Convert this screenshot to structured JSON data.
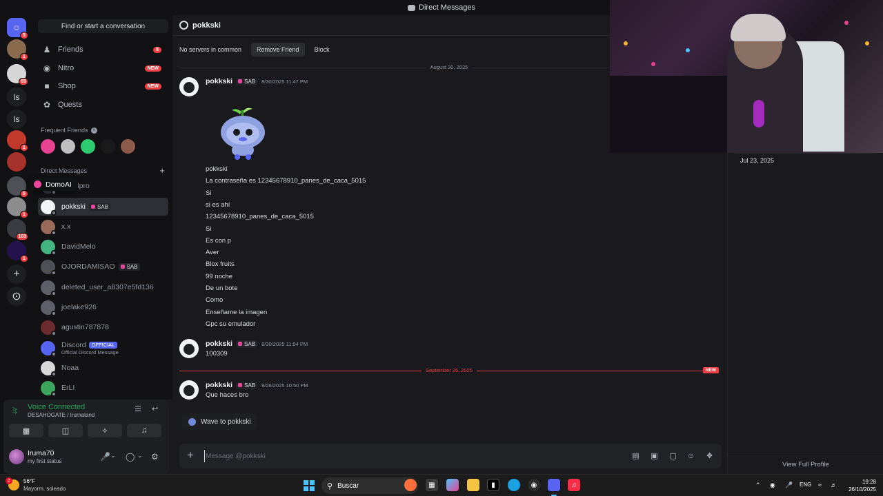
{
  "window": {
    "title": "Direct Messages"
  },
  "servers": [
    {
      "label": "",
      "badge": "5",
      "color": "#5865f2",
      "kind": "home"
    },
    {
      "label": "",
      "badge": "1",
      "color": "#8a6b4e"
    },
    {
      "label": "",
      "badge": "55",
      "color": "#d6d6d6"
    },
    {
      "label": "ls",
      "badge": "",
      "color": "#1e1f22"
    },
    {
      "label": "ls",
      "badge": "",
      "color": "#1e1f22"
    },
    {
      "label": "",
      "badge": "1",
      "color": "#c0392b"
    },
    {
      "label": "",
      "badge": "",
      "color": "#a6322b"
    },
    {
      "label": "",
      "badge": "5",
      "color": "#4e5058"
    },
    {
      "label": "",
      "badge": "1",
      "color": "#8d8d8d"
    },
    {
      "label": "",
      "badge": "103",
      "color": "#3a3c43"
    },
    {
      "label": "",
      "badge": "1",
      "color": "#24124f"
    }
  ],
  "rail_actions": {
    "add": "+",
    "discover": "⊙"
  },
  "tooltip": {
    "text": "DomoAI"
  },
  "sidebar": {
    "search_label": "Find or start a conversation",
    "nav": [
      {
        "label": "Friends",
        "badge": "5"
      },
      {
        "label": "Nitro",
        "badge": "NEW"
      },
      {
        "label": "Shop",
        "badge": "NEW"
      },
      {
        "label": "Quests",
        "badge": ""
      }
    ],
    "frequent_friends_label": "Frequent Friends",
    "frequent_friends_colors": [
      "#e84393",
      "#bfbfbf",
      "#2ecc71",
      "#1a1a1a",
      "#8d5b4c"
    ],
    "direct_messages_label": "Direct Messages",
    "dms": [
      {
        "name": "streelpro",
        "tag": "",
        "official": "",
        "sub": "",
        "color": "#3a3c43"
      },
      {
        "name": "pokkski",
        "tag": "SAB",
        "official": "",
        "sub": "",
        "color": "#f2f3f5"
      },
      {
        "name": "x.x",
        "tag": "",
        "official": "",
        "sub": "",
        "color": "#9b6b5a"
      },
      {
        "name": "DavidMelo",
        "tag": "",
        "official": "",
        "sub": "",
        "color": "#43b581"
      },
      {
        "name": "OJORDAMISAO",
        "tag": "SAB",
        "official": "",
        "sub": "",
        "color": "#4e5058"
      },
      {
        "name": "deleted_user_a8307e5fd136",
        "tag": "",
        "official": "",
        "sub": "",
        "color": "#5d6068"
      },
      {
        "name": "joelake926",
        "tag": "",
        "official": "",
        "sub": "",
        "color": "#5d6068"
      },
      {
        "name": "agustin787878",
        "tag": "",
        "official": "",
        "sub": "",
        "color": "#6b2d2d"
      },
      {
        "name": "Discord",
        "tag": "",
        "official": "OFFICIAL",
        "sub": "Official Discord Message",
        "color": "#5865f2"
      },
      {
        "name": "Noaa",
        "tag": "",
        "official": "",
        "sub": "",
        "color": "#d8d8d8"
      },
      {
        "name": "ErLI",
        "tag": "",
        "official": "",
        "sub": "",
        "color": "#3ba55c"
      }
    ]
  },
  "voice": {
    "status": "Voice Connected",
    "channel": "DESAHOGATE / Irumaland"
  },
  "user": {
    "name": "Iruma70",
    "status": "my first status"
  },
  "chat": {
    "header_name": "pokkski",
    "no_servers": "No servers in common",
    "remove_friend": "Remove Friend",
    "block": "Block",
    "date_1": "August 30, 2025",
    "date_2": "September 26, 2025",
    "new_label": "NEW",
    "messages": [
      {
        "author": "pokkski",
        "tag": "SAB",
        "time": "8/30/2025 11:47 PM",
        "lines": [
          "pokkski",
          "La contraseña es 12345678910_panes_de_caca_5015",
          "Si",
          "si es ahí",
          "12345678910_panes_de_caca_5015",
          "Si",
          "Es con p",
          "Aver",
          "Blox fruits",
          "99 noche",
          "De un bote",
          "Como",
          "Enseñame la imagen",
          "Gpc su emulador"
        ]
      },
      {
        "author": "pokkski",
        "tag": "SAB",
        "time": "8/30/2025 11:54 PM",
        "lines": [
          "100309"
        ]
      },
      {
        "author": "pokkski",
        "tag": "SAB",
        "time": "9/26/2025 10:50 PM",
        "lines": [
          "Que haces bro"
        ]
      }
    ],
    "wave_label": "Wave to pokkski",
    "composer_placeholder": "Message @pokkski"
  },
  "profile": {
    "member_since": "Jul 23, 2025",
    "view_full": "View Full Profile"
  },
  "taskbar": {
    "weather_temp": "56°F",
    "weather_desc": "Mayorm. soleado",
    "weather_badge": "2",
    "search_label": "Buscar",
    "lang": "ENG",
    "time": "19:28",
    "date": "26/10/2025"
  }
}
